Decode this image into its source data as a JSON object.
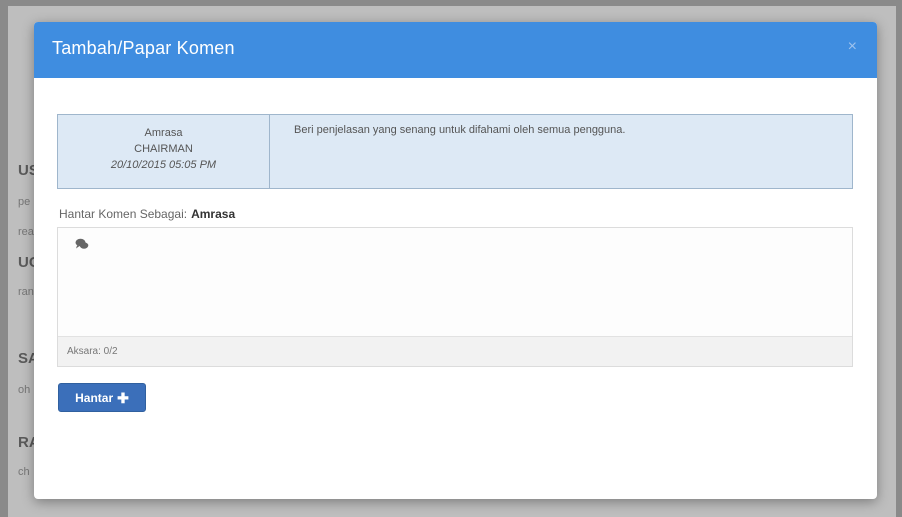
{
  "background": {
    "fragments": [
      "USI",
      "pe",
      "rea",
      "UC",
      "ran",
      "SA",
      "oh",
      "RA",
      "ch"
    ]
  },
  "modal": {
    "title": "Tambah/Papar Komen",
    "close_glyph": "×",
    "comment": {
      "author": "Amrasa",
      "role": "CHAIRMAN",
      "date": "20/10/2015 05:05 PM",
      "text": "Beri penjelasan yang senang untuk difahami oleh semua pengguna."
    },
    "sender": {
      "label": "Hantar Komen Sebagai:",
      "name": "Amrasa"
    },
    "input": {
      "value": "",
      "placeholder": "",
      "icon": "comment-icon",
      "counter_text": "Aksara: 0/2"
    },
    "submit": {
      "label": "Hantar",
      "icon_glyph": "✚"
    }
  },
  "colors": {
    "header": "#3f8de0",
    "button": "#3b6fba",
    "table_bg": "#dde9f5"
  }
}
